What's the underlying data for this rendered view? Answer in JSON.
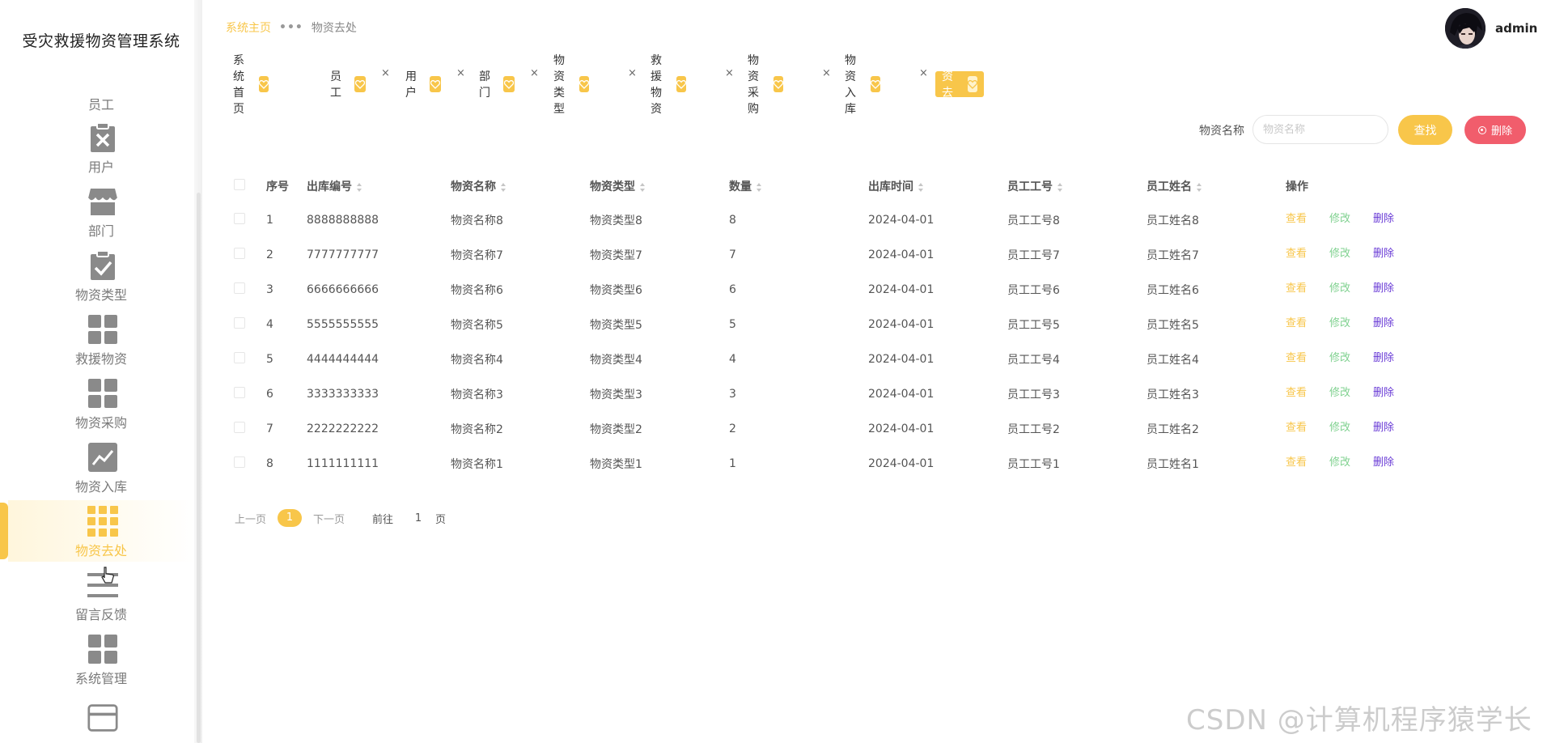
{
  "app": {
    "title": "受灾救援物资管理系统"
  },
  "sidebar": {
    "items": [
      {
        "label": "员工",
        "icon": "employee-icon"
      },
      {
        "label": "用户",
        "icon": "clipboard-x-icon"
      },
      {
        "label": "部门",
        "icon": "shop-icon"
      },
      {
        "label": "物资类型",
        "icon": "clipboard-check-icon"
      },
      {
        "label": "救援物资",
        "icon": "grid-icon"
      },
      {
        "label": "物资采购",
        "icon": "grid-icon"
      },
      {
        "label": "物资入库",
        "icon": "chart-icon"
      },
      {
        "label": "物资去处",
        "icon": "grid-9-icon",
        "active": true
      },
      {
        "label": "留言反馈",
        "icon": "list-icon"
      },
      {
        "label": "系统管理",
        "icon": "grid-icon"
      },
      {
        "label": "",
        "icon": "card-icon"
      }
    ]
  },
  "header": {
    "breadcrumb": {
      "home": "系统主页",
      "current": "物资去处"
    },
    "user": {
      "name": "admin"
    }
  },
  "tags": [
    {
      "label": "系统首页",
      "closable": false
    },
    {
      "label": "员工",
      "closable": true
    },
    {
      "label": "用户",
      "closable": true
    },
    {
      "label": "部门",
      "closable": true
    },
    {
      "label": "物资类型",
      "closable": true
    },
    {
      "label": "救援物资",
      "closable": true
    },
    {
      "label": "物资采购",
      "closable": true
    },
    {
      "label": "物资入库",
      "closable": true
    },
    {
      "label": "物资去处",
      "closable": true,
      "active": true
    }
  ],
  "search": {
    "label": "物资名称",
    "placeholder": "物资名称",
    "value": "",
    "search_button": "查找",
    "delete_button": "删除"
  },
  "table": {
    "columns": [
      "序号",
      "出库编号",
      "物资名称",
      "物资类型",
      "数量",
      "出库时间",
      "员工工号",
      "员工姓名",
      "操作"
    ],
    "rows": [
      {
        "index": "1",
        "code": "8888888888",
        "name": "物资名称8",
        "type": "物资类型8",
        "qty": "8",
        "time": "2024-04-01",
        "emp_no": "员工工号8",
        "emp_name": "员工姓名8"
      },
      {
        "index": "2",
        "code": "7777777777",
        "name": "物资名称7",
        "type": "物资类型7",
        "qty": "7",
        "time": "2024-04-01",
        "emp_no": "员工工号7",
        "emp_name": "员工姓名7"
      },
      {
        "index": "3",
        "code": "6666666666",
        "name": "物资名称6",
        "type": "物资类型6",
        "qty": "6",
        "time": "2024-04-01",
        "emp_no": "员工工号6",
        "emp_name": "员工姓名6"
      },
      {
        "index": "4",
        "code": "5555555555",
        "name": "物资名称5",
        "type": "物资类型5",
        "qty": "5",
        "time": "2024-04-01",
        "emp_no": "员工工号5",
        "emp_name": "员工姓名5"
      },
      {
        "index": "5",
        "code": "4444444444",
        "name": "物资名称4",
        "type": "物资类型4",
        "qty": "4",
        "time": "2024-04-01",
        "emp_no": "员工工号4",
        "emp_name": "员工姓名4"
      },
      {
        "index": "6",
        "code": "3333333333",
        "name": "物资名称3",
        "type": "物资类型3",
        "qty": "3",
        "time": "2024-04-01",
        "emp_no": "员工工号3",
        "emp_name": "员工姓名3"
      },
      {
        "index": "7",
        "code": "2222222222",
        "name": "物资名称2",
        "type": "物资类型2",
        "qty": "2",
        "time": "2024-04-01",
        "emp_no": "员工工号2",
        "emp_name": "员工姓名2"
      },
      {
        "index": "8",
        "code": "1111111111",
        "name": "物资名称1",
        "type": "物资类型1",
        "qty": "1",
        "time": "2024-04-01",
        "emp_no": "员工工号1",
        "emp_name": "员工姓名1"
      }
    ],
    "actions": {
      "view": "查看",
      "edit": "修改",
      "delete": "删除"
    }
  },
  "pagination": {
    "prev": "上一页",
    "current": "1",
    "next": "下一页",
    "goto": "前往",
    "page_input": "1",
    "unit": "页"
  },
  "watermark": "CSDN @计算机程序猿学长",
  "colors": {
    "accent": "#f8c64a",
    "danger": "#f15d6c",
    "edit": "#7fd18f",
    "delete_link": "#6a3cd6"
  }
}
